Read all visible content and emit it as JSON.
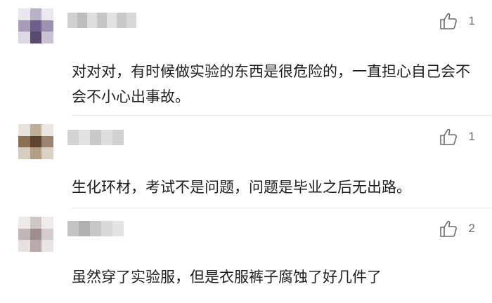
{
  "comments": [
    {
      "text": "对对对，有时候做实验的东西是很危险的，一直担心自己会不会不小心出事故。",
      "likes": "1"
    },
    {
      "text": "生化环材，考试不是问题，问题是毕业之后无出路。",
      "likes": "1"
    },
    {
      "text": "虽然穿了实验服，但是衣服裤子腐蚀了好几件了",
      "likes": "2"
    }
  ],
  "colors": {
    "text": "#1e1e1e",
    "meta": "#6a6a6a",
    "divider": "#e6e6e6"
  },
  "icons": {
    "like": "thumbs-up-icon"
  }
}
